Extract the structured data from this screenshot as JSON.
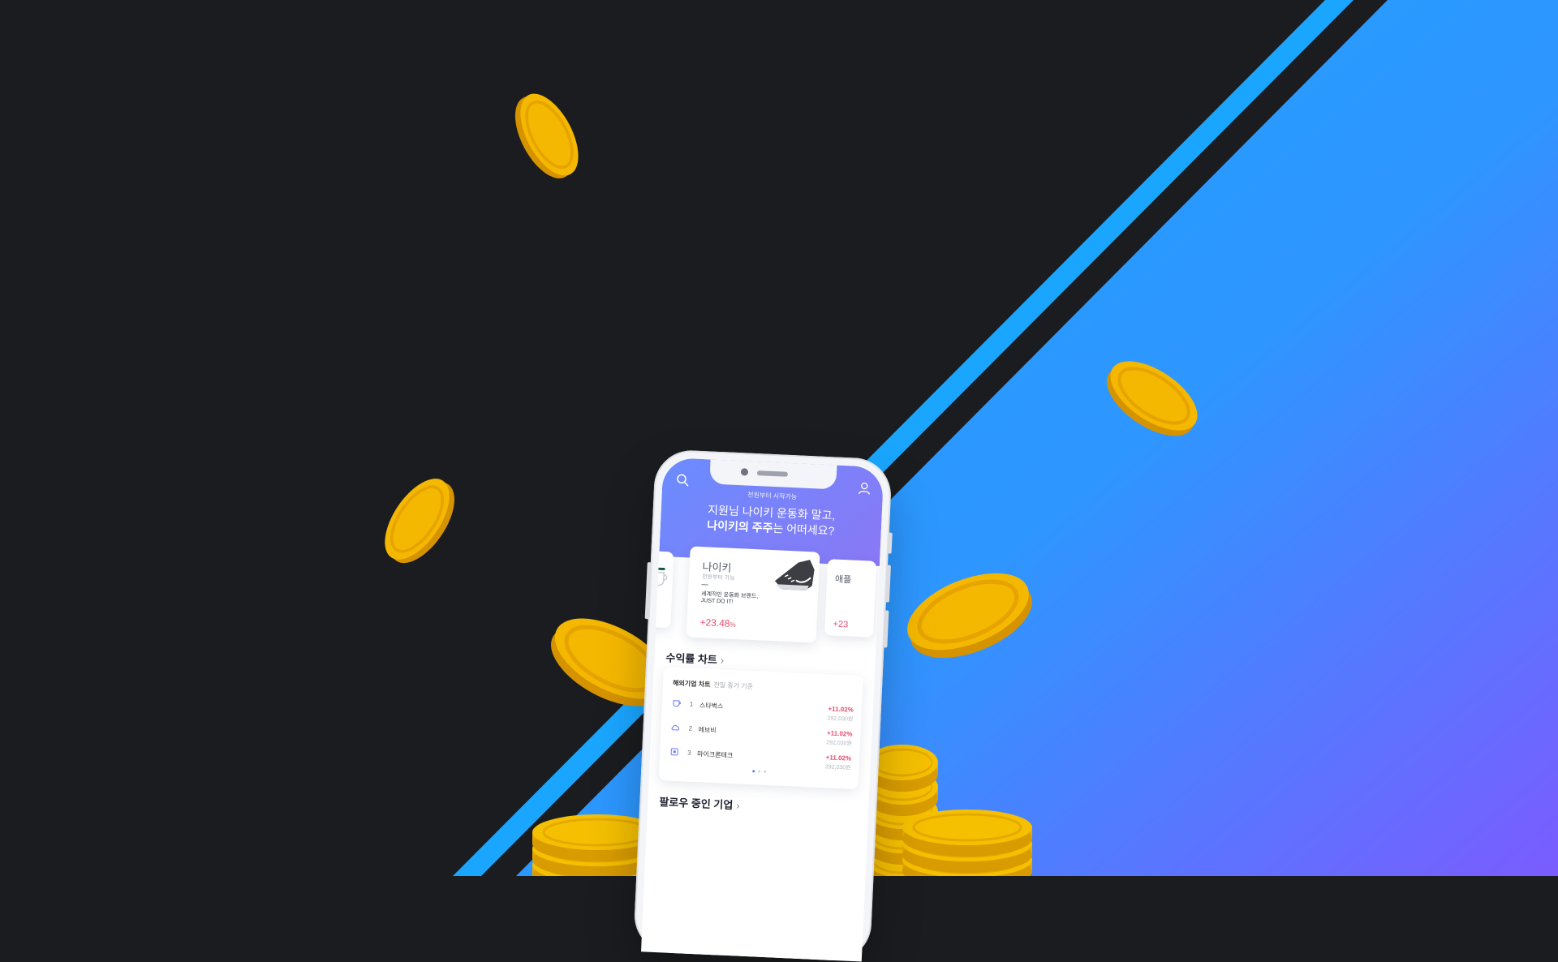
{
  "colors": {
    "background_dark": "#1b1c1f",
    "stripe_blue": "#1aa6ff",
    "gradient_blue": "#24a3ff",
    "gradient_purple": "#7b5cff",
    "coin_gold": "#f5b800",
    "rise_red": "#e84a6e"
  },
  "app": {
    "header": {
      "subtitle": "천원부터 시작가능",
      "line1": "지원님 나이키 운동화 말고,",
      "line2_bold": "나이키의 주주",
      "line2_rest": "는 어떠세요?",
      "search_icon": "search-icon",
      "profile_icon": "user-icon"
    },
    "featured_card": {
      "name": "나이키",
      "sub": "천원부터 가능",
      "desc1": "세계적인 운동화 브랜드,",
      "desc2": "JUST DO IT!",
      "change": "+23.48",
      "change_unit": "%",
      "icon": "sneaker-icon"
    },
    "left_card": {
      "icon": "coffee-cup-icon"
    },
    "right_card": {
      "name": "애플",
      "change": "+23"
    },
    "returns_section": {
      "title": "수익률 차트",
      "chevron": "›",
      "card_title": "해외기업 차트",
      "card_subtitle": "전일 종가 기준",
      "rows": [
        {
          "rank": "1",
          "name": "스타벅스",
          "change": "+11.02%",
          "price": "292,030원",
          "icon": "coffee-cup-icon"
        },
        {
          "rank": "2",
          "name": "에브비",
          "change": "+11.02%",
          "price": "292,030원",
          "icon": "cloud-icon"
        },
        {
          "rank": "3",
          "name": "마이크론테크",
          "change": "+11.02%",
          "price": "292,030원",
          "icon": "chip-icon"
        }
      ]
    },
    "following_section": {
      "title": "팔로우 중인 기업",
      "chevron": "›"
    }
  }
}
